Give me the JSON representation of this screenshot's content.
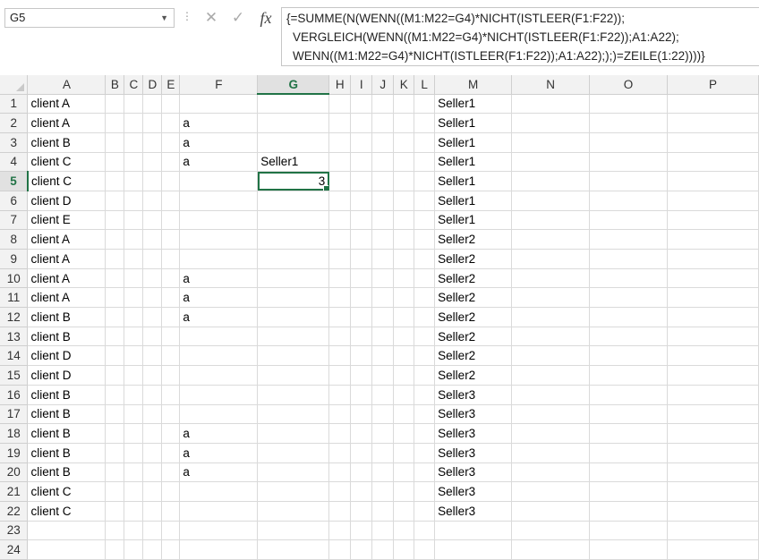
{
  "name_box": "G5",
  "formula_lines": [
    "{=SUMME(N(WENN((M1:M22=G4)*NICHT(ISTLEER(F1:F22));",
    "VERGLEICH(WENN((M1:M22=G4)*NICHT(ISTLEER(F1:F22));A1:A22);",
    "WENN((M1:M22=G4)*NICHT(ISTLEER(F1:F22));A1:A22););)=ZEILE(1:22))))}"
  ],
  "icons": {
    "cancel": "x-icon",
    "enter": "check-icon",
    "function": "fx-icon",
    "dropdown": "chevron-down-icon"
  },
  "accent_color": "#217346",
  "columns": [
    "A",
    "B",
    "C",
    "D",
    "E",
    "F",
    "G",
    "H",
    "I",
    "J",
    "K",
    "L",
    "M",
    "N",
    "O",
    "P"
  ],
  "selected_column": "G",
  "selected_row": "5",
  "rows": [
    {
      "n": "1",
      "A": "client A",
      "F": "",
      "G": "",
      "M": "Seller1"
    },
    {
      "n": "2",
      "A": "client A",
      "F": "a",
      "G": "",
      "M": "Seller1"
    },
    {
      "n": "3",
      "A": "client B",
      "F": "a",
      "G": "",
      "M": "Seller1"
    },
    {
      "n": "4",
      "A": "client C",
      "F": "a",
      "G": "Seller1",
      "M": "Seller1"
    },
    {
      "n": "5",
      "A": "client C",
      "F": "",
      "G": "3",
      "M": "Seller1"
    },
    {
      "n": "6",
      "A": "client D",
      "F": "",
      "G": "",
      "M": "Seller1"
    },
    {
      "n": "7",
      "A": "client E",
      "F": "",
      "G": "",
      "M": "Seller1"
    },
    {
      "n": "8",
      "A": "client A",
      "F": "",
      "G": "",
      "M": "Seller2"
    },
    {
      "n": "9",
      "A": "client A",
      "F": "",
      "G": "",
      "M": "Seller2"
    },
    {
      "n": "10",
      "A": "client A",
      "F": "a",
      "G": "",
      "M": "Seller2"
    },
    {
      "n": "11",
      "A": "client A",
      "F": "a",
      "G": "",
      "M": "Seller2"
    },
    {
      "n": "12",
      "A": "client B",
      "F": "a",
      "G": "",
      "M": "Seller2"
    },
    {
      "n": "13",
      "A": "client B",
      "F": "",
      "G": "",
      "M": "Seller2"
    },
    {
      "n": "14",
      "A": "client D",
      "F": "",
      "G": "",
      "M": "Seller2"
    },
    {
      "n": "15",
      "A": "client D",
      "F": "",
      "G": "",
      "M": "Seller2"
    },
    {
      "n": "16",
      "A": "client B",
      "F": "",
      "G": "",
      "M": "Seller3"
    },
    {
      "n": "17",
      "A": "client B",
      "F": "",
      "G": "",
      "M": "Seller3"
    },
    {
      "n": "18",
      "A": "client B",
      "F": "a",
      "G": "",
      "M": "Seller3"
    },
    {
      "n": "19",
      "A": "client B",
      "F": "a",
      "G": "",
      "M": "Seller3"
    },
    {
      "n": "20",
      "A": "client B",
      "F": "a",
      "G": "",
      "M": "Seller3"
    },
    {
      "n": "21",
      "A": "client C",
      "F": "",
      "G": "",
      "M": "Seller3"
    },
    {
      "n": "22",
      "A": "client C",
      "F": "",
      "G": "",
      "M": "Seller3"
    },
    {
      "n": "23",
      "A": "",
      "F": "",
      "G": "",
      "M": ""
    },
    {
      "n": "24",
      "A": "",
      "F": "",
      "G": "",
      "M": ""
    }
  ]
}
